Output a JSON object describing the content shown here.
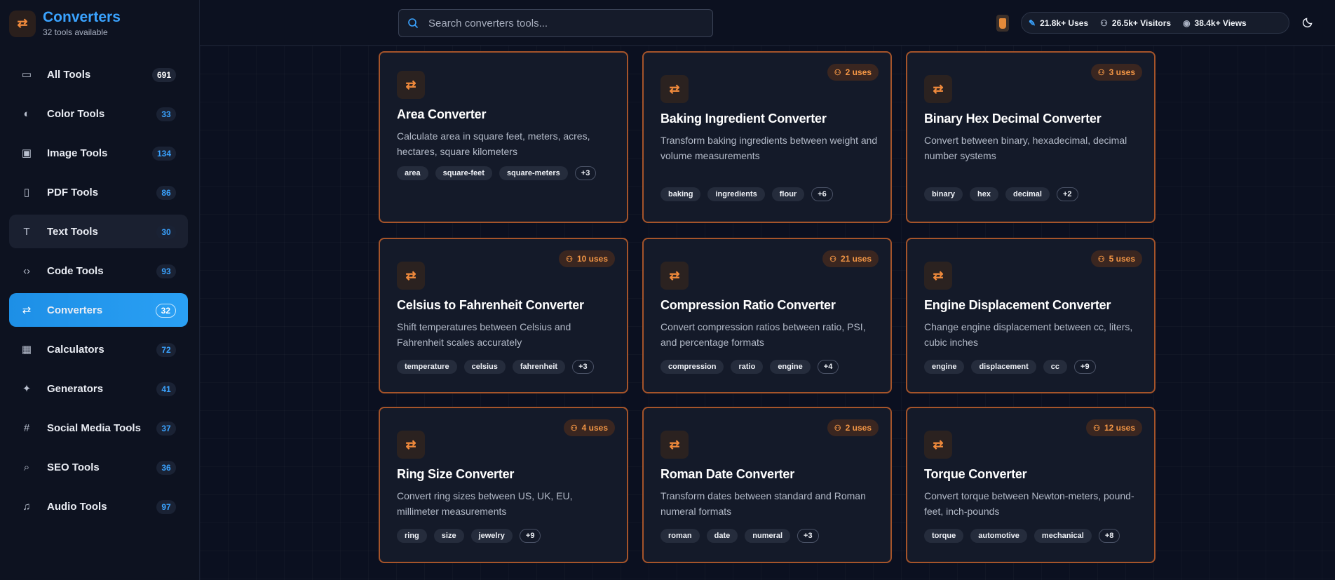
{
  "brand": {
    "title": "Converters",
    "subtitle": "32 tools available"
  },
  "sidebar": {
    "items": [
      {
        "label": "All Tools",
        "count": "691",
        "icon": "briefcase-icon",
        "state": "normal"
      },
      {
        "label": "Color Tools",
        "count": "33",
        "icon": "palette-icon",
        "state": "normal"
      },
      {
        "label": "Image Tools",
        "count": "134",
        "icon": "image-icon",
        "state": "normal"
      },
      {
        "label": "PDF Tools",
        "count": "86",
        "icon": "file-icon",
        "state": "normal"
      },
      {
        "label": "Text Tools",
        "count": "30",
        "icon": "text-icon",
        "state": "hover"
      },
      {
        "label": "Code Tools",
        "count": "93",
        "icon": "code-icon",
        "state": "normal"
      },
      {
        "label": "Converters",
        "count": "32",
        "icon": "swap-icon",
        "state": "active"
      },
      {
        "label": "Calculators",
        "count": "72",
        "icon": "calculator-icon",
        "state": "normal"
      },
      {
        "label": "Generators",
        "count": "41",
        "icon": "sparkles-icon",
        "state": "normal"
      },
      {
        "label": "Social Media Tools",
        "count": "37",
        "icon": "hash-icon",
        "state": "normal"
      },
      {
        "label": "SEO Tools",
        "count": "36",
        "icon": "search-icon",
        "state": "normal"
      },
      {
        "label": "Audio Tools",
        "count": "97",
        "icon": "music-icon",
        "state": "normal"
      }
    ]
  },
  "header": {
    "search_placeholder": "Search converters tools...",
    "stats": {
      "uses": "21.8k+ Uses",
      "visitors": "26.5k+ Visitors",
      "views": "38.4k+ Views"
    }
  },
  "cards": [
    {
      "title": "Area Converter",
      "uses": "",
      "desc": "Calculate area in square feet, meters, acres, hectares, square kilometers",
      "tags": [
        "area",
        "square-feet",
        "square-meters"
      ],
      "more": "+3"
    },
    {
      "title": "Baking Ingredient Converter",
      "uses": "2 uses",
      "desc": "Transform baking ingredients between weight and volume measurements",
      "tags": [
        "baking",
        "ingredients",
        "flour"
      ],
      "more": "+6"
    },
    {
      "title": "Binary Hex Decimal Converter",
      "uses": "3 uses",
      "desc": "Convert between binary, hexadecimal, decimal number systems",
      "tags": [
        "binary",
        "hex",
        "decimal"
      ],
      "more": "+2"
    },
    {
      "title": "Celsius to Fahrenheit Converter",
      "uses": "10 uses",
      "desc": "Shift temperatures between Celsius and Fahrenheit scales accurately",
      "tags": [
        "temperature",
        "celsius",
        "fahrenheit"
      ],
      "more": "+3"
    },
    {
      "title": "Compression Ratio Converter",
      "uses": "21 uses",
      "desc": "Convert compression ratios between ratio, PSI, and percentage formats",
      "tags": [
        "compression",
        "ratio",
        "engine"
      ],
      "more": "+4"
    },
    {
      "title": "Engine Displacement Converter",
      "uses": "5 uses",
      "desc": "Change engine displacement between cc, liters, cubic inches",
      "tags": [
        "engine",
        "displacement",
        "cc"
      ],
      "more": "+9"
    },
    {
      "title": "Ring Size Converter",
      "uses": "4 uses",
      "desc": "Convert ring sizes between US, UK, EU, millimeter measurements",
      "tags": [
        "ring",
        "size",
        "jewelry"
      ],
      "more": "+9"
    },
    {
      "title": "Roman Date Converter",
      "uses": "2 uses",
      "desc": "Transform dates between standard and Roman numeral formats",
      "tags": [
        "roman",
        "date",
        "numeral"
      ],
      "more": "+3"
    },
    {
      "title": "Torque Converter",
      "uses": "12 uses",
      "desc": "Convert torque between Newton-meters, pound-feet, inch-pounds",
      "tags": [
        "torque",
        "automotive",
        "mechanical"
      ],
      "more": "+8"
    }
  ],
  "colors": {
    "accent": "#1d8fe6",
    "card_border": "#a5542a",
    "uses_badge": "#f39645"
  }
}
